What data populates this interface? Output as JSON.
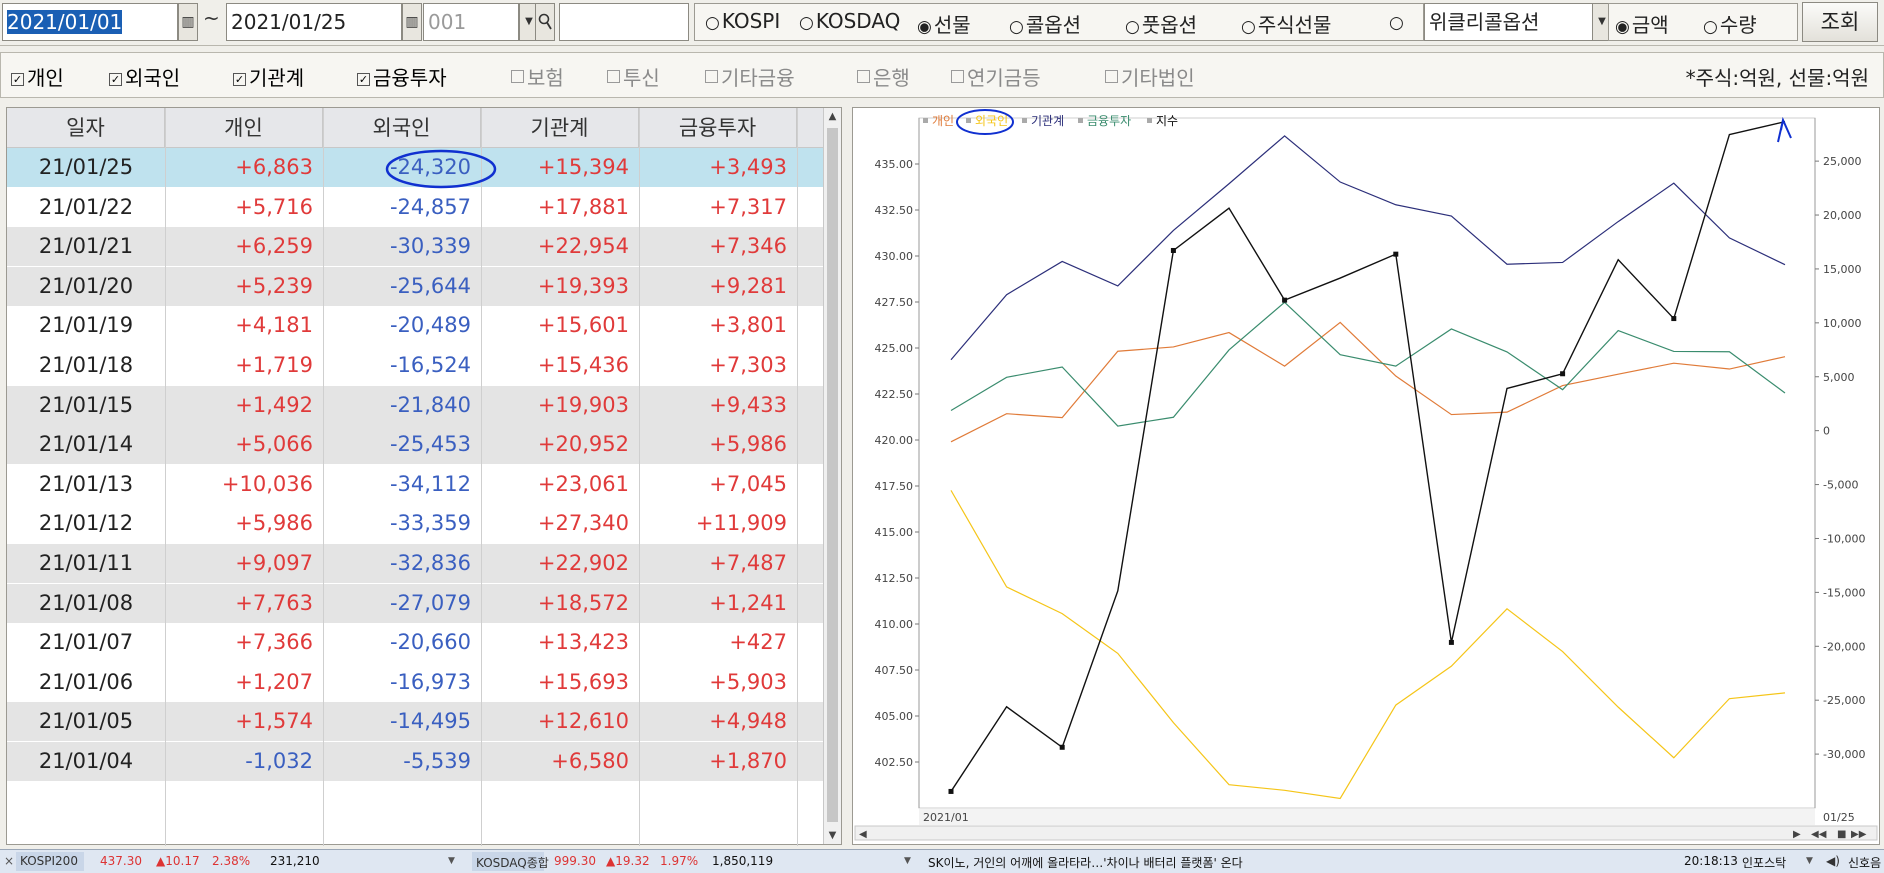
{
  "toolbar": {
    "date_from": "2021/01/01",
    "tilde": "~",
    "date_to": "2021/01/25",
    "code_placeholder": "001",
    "dropdown_arrow": "▼",
    "market_options": [
      {
        "label": "KOSPI",
        "checked": false
      },
      {
        "label": "KOSDAQ",
        "checked": false
      },
      {
        "label": "선물",
        "checked": true
      },
      {
        "label": "콜옵션",
        "checked": false
      },
      {
        "label": "풋옵션",
        "checked": false
      },
      {
        "label": "주식선물",
        "checked": false
      },
      {
        "label": "",
        "checked": false
      }
    ],
    "product_select": "위클리콜옵션",
    "value_options": [
      {
        "label": "금액",
        "checked": true
      },
      {
        "label": "수량",
        "checked": false
      }
    ],
    "query_label": "조회"
  },
  "filters": {
    "items": [
      {
        "label": "개인",
        "checked": true
      },
      {
        "label": "외국인",
        "checked": true
      },
      {
        "label": "기관계",
        "checked": true
      },
      {
        "label": "금융투자",
        "checked": true
      },
      {
        "label": "보험",
        "checked": false
      },
      {
        "label": "투신",
        "checked": false
      },
      {
        "label": "기타금융",
        "checked": false
      },
      {
        "label": "은행",
        "checked": false
      },
      {
        "label": "연기금등",
        "checked": false
      },
      {
        "label": "기타법인",
        "checked": false
      }
    ],
    "unit_note": "*주식:억원, 선물:억원"
  },
  "table": {
    "columns": [
      "일자",
      "개인",
      "외국인",
      "기관계",
      "금융투자"
    ],
    "rows": [
      [
        "21/01/25",
        "+6,863",
        "-24,320",
        "+15,394",
        "+3,493"
      ],
      [
        "21/01/22",
        "+5,716",
        "-24,857",
        "+17,881",
        "+7,317"
      ],
      [
        "21/01/21",
        "+6,259",
        "-30,339",
        "+22,954",
        "+7,346"
      ],
      [
        "21/01/20",
        "+5,239",
        "-25,644",
        "+19,393",
        "+9,281"
      ],
      [
        "21/01/19",
        "+4,181",
        "-20,489",
        "+15,601",
        "+3,801"
      ],
      [
        "21/01/18",
        "+1,719",
        "-16,524",
        "+15,436",
        "+7,303"
      ],
      [
        "21/01/15",
        "+1,492",
        "-21,840",
        "+19,903",
        "+9,433"
      ],
      [
        "21/01/14",
        "+5,066",
        "-25,453",
        "+20,952",
        "+5,986"
      ],
      [
        "21/01/13",
        "+10,036",
        "-34,112",
        "+23,061",
        "+7,045"
      ],
      [
        "21/01/12",
        "+5,986",
        "-33,359",
        "+27,340",
        "+11,909"
      ],
      [
        "21/01/11",
        "+9,097",
        "-32,836",
        "+22,902",
        "+7,487"
      ],
      [
        "21/01/08",
        "+7,763",
        "-27,079",
        "+18,572",
        "+1,241"
      ],
      [
        "21/01/07",
        "+7,366",
        "-20,660",
        "+13,423",
        "+427"
      ],
      [
        "21/01/06",
        "+1,207",
        "-16,973",
        "+15,693",
        "+5,903"
      ],
      [
        "21/01/05",
        "+1,574",
        "-14,495",
        "+12,610",
        "+4,948"
      ],
      [
        "21/01/04",
        "-1,032",
        "-5,539",
        "+6,580",
        "+1,870"
      ]
    ]
  },
  "chart_data": {
    "type": "line",
    "legend": [
      "개인",
      "외국인",
      "기관계",
      "금융투자",
      "지수"
    ],
    "legend_placement": "top-left",
    "colors": {
      "개인": "#e07b39",
      "외국인": "#f5c518",
      "기관계": "#2c2f7a",
      "금융투자": "#3a8c6e",
      "지수": "#111111"
    },
    "left_axis": {
      "ticks": [
        "435.00",
        "432.50",
        "430.00",
        "427.50",
        "425.00",
        "422.50",
        "420.00",
        "417.50",
        "415.00",
        "412.50",
        "410.00",
        "407.50",
        "405.00",
        "402.50"
      ],
      "ylim": [
        400.0,
        437.5
      ]
    },
    "right_axis": {
      "ticks": [
        "25,000",
        "20,000",
        "15,000",
        "10,000",
        "5,000",
        "0",
        "-5,000",
        "-10,000",
        "-15,000",
        "-20,000",
        "-25,000",
        "-30,000"
      ],
      "ylim": [
        -35000,
        29000
      ]
    },
    "x_start_label": "2021/01",
    "x_end_label": "01/25",
    "x": [
      "21/01/04",
      "21/01/05",
      "21/01/06",
      "21/01/07",
      "21/01/08",
      "21/01/11",
      "21/01/12",
      "21/01/13",
      "21/01/14",
      "21/01/15",
      "21/01/18",
      "21/01/19",
      "21/01/20",
      "21/01/21",
      "21/01/22",
      "21/01/25"
    ],
    "series": [
      {
        "name": "개인",
        "axis": "right",
        "values": [
          -1032,
          1574,
          1207,
          7366,
          7763,
          9097,
          5986,
          10036,
          5066,
          1492,
          1719,
          4181,
          5239,
          6259,
          5716,
          6863
        ]
      },
      {
        "name": "외국인",
        "axis": "right",
        "values": [
          -5539,
          -14495,
          -16973,
          -20660,
          -27079,
          -32836,
          -33359,
          -34112,
          -25453,
          -21840,
          -16524,
          -20489,
          -25644,
          -30339,
          -24857,
          -24320
        ]
      },
      {
        "name": "기관계",
        "axis": "right",
        "values": [
          6580,
          12610,
          15693,
          13423,
          18572,
          22902,
          27340,
          23061,
          20952,
          19903,
          15436,
          15601,
          19393,
          22954,
          17881,
          15394
        ]
      },
      {
        "name": "금융투자",
        "axis": "right",
        "values": [
          1870,
          4948,
          5903,
          427,
          1241,
          7487,
          11909,
          7045,
          5986,
          9433,
          7303,
          3801,
          9281,
          7346,
          7317,
          3493
        ]
      },
      {
        "name": "지수",
        "axis": "left",
        "values": [
          400.9,
          405.5,
          403.3,
          411.8,
          430.3,
          432.6,
          427.6,
          428.8,
          430.1,
          409.0,
          422.8,
          423.6,
          429.8,
          426.6,
          436.6,
          437.3
        ]
      }
    ]
  },
  "statusbar": {
    "kospi200_name": "KOSPI200",
    "kospi200_value": "437.30",
    "kospi200_change": "▲10.17",
    "kospi200_pct": "2.38%",
    "kospi200_volume": "231,210",
    "kosdaq_name": "KOSDAQ종합",
    "kosdaq_value": "999.30",
    "kosdaq_change": "▲19.32",
    "kosdaq_pct": "1.97%",
    "kosdaq_volume": "1,850,119",
    "news": "SK이노, 거인의 어깨에 올라타라…'차이나 배터리 플랫폼' 온다",
    "time": "20:18:13",
    "source": "인포스탁",
    "sound": "신호음"
  },
  "annotation_colors": {
    "circle": "#1030d0"
  }
}
